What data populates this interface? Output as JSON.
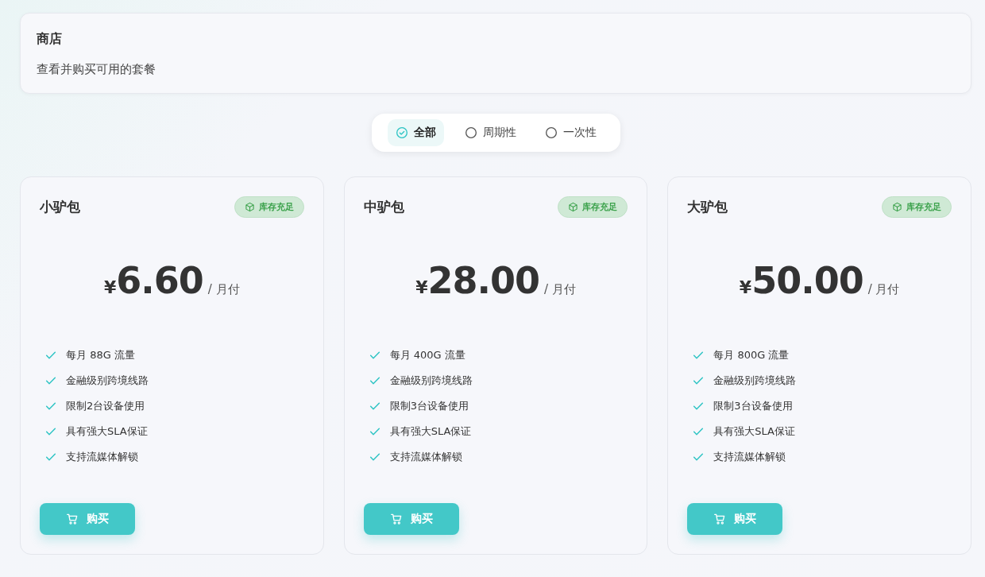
{
  "header": {
    "title": "商店",
    "subtitle": "查看并购买可用的套餐"
  },
  "filters": [
    {
      "label": "全部",
      "selected": true
    },
    {
      "label": "周期性",
      "selected": false
    },
    {
      "label": "一次性",
      "selected": false
    }
  ],
  "plans": [
    {
      "name": "小驴包",
      "stock": "库存充足",
      "currency": "¥",
      "price": "6.60",
      "period": "/ 月付",
      "features": [
        "每月 88G 流量",
        "金融级别跨境线路",
        "限制2台设备使用",
        "具有强大SLA保证",
        "支持流媒体解锁"
      ],
      "button": "购买"
    },
    {
      "name": "中驴包",
      "stock": "库存充足",
      "currency": "¥",
      "price": "28.00",
      "period": "/ 月付",
      "features": [
        "每月 400G 流量",
        "金融级别跨境线路",
        "限制3台设备使用",
        "具有强大SLA保证",
        "支持流媒体解锁"
      ],
      "button": "购买"
    },
    {
      "name": "大驴包",
      "stock": "库存充足",
      "currency": "¥",
      "price": "50.00",
      "period": "/ 月付",
      "features": [
        "每月 800G 流量",
        "金融级别跨境线路",
        "限制3台设备使用",
        "具有强大SLA保证",
        "支持流媒体解锁"
      ],
      "button": "购买"
    }
  ]
}
